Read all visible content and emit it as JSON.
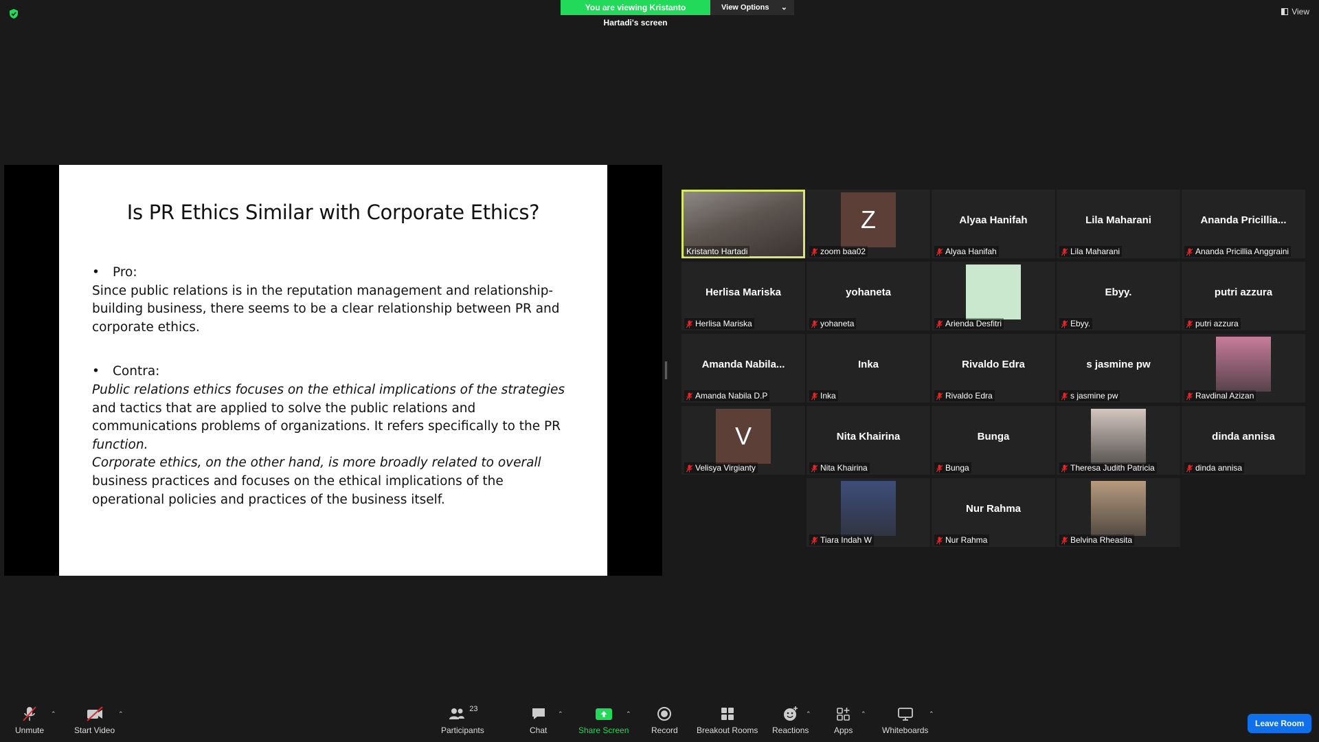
{
  "top_bar": {
    "banner_text": "You are viewing Kristanto Hartadi's screen",
    "view_options_label": "View Options",
    "view_label": "View"
  },
  "slide": {
    "title": "Is PR Ethics Similar with Corporate Ethics?",
    "pro_heading": "Pro:",
    "pro_text": "Since public relations is in the reputation management and relationship-building business, there seems to be a clear relationship between PR and corporate ethics.",
    "contra_heading": "Contra:",
    "contra_italic_1": "Public relations ethics focuses on the ethical implications of the strategies",
    "contra_text_1": " and tactics that are applied to solve the public relations and communications problems of organizations. It refers specifically to the PR ",
    "contra_italic_2": "function.",
    "contra_italic_3": "Corporate ethics, on the other hand, is more broadly related to overall",
    "contra_text_2": " business practices and focuses on the ethical implications of the operational policies and practices of the business itself."
  },
  "participants": [
    {
      "name": "Kristanto Hartadi",
      "display": "",
      "avatar": "video",
      "active": true,
      "muted": false
    },
    {
      "name": "zoom baa02",
      "display": "",
      "avatar": "letter",
      "letter": "Z",
      "muted": true
    },
    {
      "name": "Alyaa Hanifah",
      "display": "Alyaa Hanifah",
      "avatar": "none",
      "muted": true
    },
    {
      "name": "Lila Maharani",
      "display": "Lila Maharani",
      "avatar": "none",
      "muted": true
    },
    {
      "name": "Ananda Pricillia Anggraini",
      "display": "Ananda  Pricillia...",
      "avatar": "none",
      "muted": true
    },
    {
      "name": "Herlisa Mariska",
      "display": "Herlisa Mariska",
      "avatar": "none",
      "muted": true
    },
    {
      "name": "yohaneta",
      "display": "yohaneta",
      "avatar": "none",
      "muted": true
    },
    {
      "name": "Arienda Desfitri",
      "display": "",
      "avatar": "green",
      "muted": true
    },
    {
      "name": "Ebyy.",
      "display": "Ebyy.",
      "avatar": "none",
      "muted": true
    },
    {
      "name": "putri azzura",
      "display": "putri azzura",
      "avatar": "none",
      "muted": true
    },
    {
      "name": "Amanda Nabila D.P",
      "display": "Amanda  Nabila...",
      "avatar": "none",
      "muted": true
    },
    {
      "name": "Inka",
      "display": "Inka",
      "avatar": "none",
      "muted": true
    },
    {
      "name": "Rivaldo Edra",
      "display": "Rivaldo Edra",
      "avatar": "none",
      "muted": true
    },
    {
      "name": "s jasmine pw",
      "display": "s jasmine pw",
      "avatar": "none",
      "muted": true
    },
    {
      "name": "Ravdinal Azizan",
      "display": "",
      "avatar": "photo",
      "photo_color": "#c77c9a",
      "muted": true
    },
    {
      "name": "Velisya Virgianty",
      "display": "",
      "avatar": "letter",
      "letter": "V",
      "muted": true
    },
    {
      "name": "Nita Khairina",
      "display": "Nita Khairina",
      "avatar": "none",
      "muted": true
    },
    {
      "name": "Bunga",
      "display": "Bunga",
      "avatar": "none",
      "muted": true
    },
    {
      "name": "Theresa Judith Patricia",
      "display": "",
      "avatar": "photo",
      "photo_color": "#d4c6bf",
      "muted": true
    },
    {
      "name": "dinda annisa",
      "display": "dinda annisa",
      "avatar": "none",
      "muted": true
    },
    {
      "name": "Tiara Indah W",
      "display": "",
      "avatar": "photo",
      "photo_color": "#3e4d7a",
      "muted": true
    },
    {
      "name": "Nur Rahma",
      "display": "Nur Rahma",
      "avatar": "none",
      "muted": true
    },
    {
      "name": "Belvina Rheasita",
      "display": "",
      "avatar": "photo",
      "photo_color": "#b79a7e",
      "muted": true
    }
  ],
  "toolbar": {
    "unmute": "Unmute",
    "start_video": "Start Video",
    "participants": "Participants",
    "participants_count": "23",
    "chat": "Chat",
    "share_screen": "Share Screen",
    "record": "Record",
    "breakout_rooms": "Breakout Rooms",
    "reactions": "Reactions",
    "apps": "Apps",
    "whiteboards": "Whiteboards",
    "leave_room": "Leave Room"
  },
  "colors": {
    "banner_green": "#23d959",
    "share_green": "#23d959",
    "leave_blue": "#0e71eb",
    "muted_red": "#e02828",
    "active_outline": "#d7e86a"
  }
}
